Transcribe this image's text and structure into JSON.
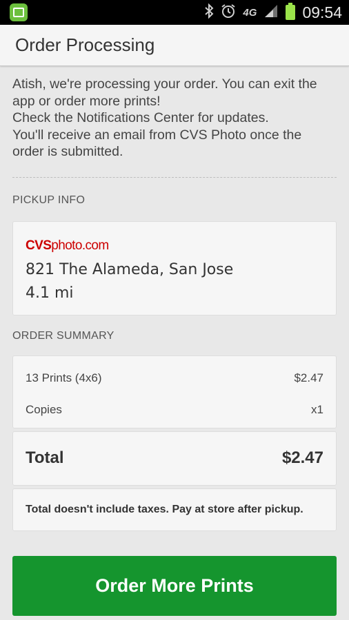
{
  "status_bar": {
    "time": "09:54",
    "network": "4G",
    "icons": [
      "gallery-app-icon",
      "bluetooth-icon",
      "alarm-icon",
      "4g-icon",
      "signal-icon",
      "battery-icon"
    ]
  },
  "header": {
    "title": "Order Processing"
  },
  "intro": {
    "line1": "Atish, we're processing your order. You can exit the app or order more prints!",
    "line2": "Check the Notifications Center for updates.",
    "line3": "You'll receive an email from CVS Photo once the order is submitted."
  },
  "pickup": {
    "section_label": "PICKUP INFO",
    "logo_bold": "CVS",
    "logo_rest": "photo.com",
    "address": "821 The Alameda, San Jose",
    "distance": "4.1 mi"
  },
  "summary": {
    "section_label": "ORDER SUMMARY",
    "item_label": "13 Prints (4x6)",
    "item_price": "$2.47",
    "copies_label": "Copies",
    "copies_value": "x1",
    "total_label": "Total",
    "total_value": "$2.47",
    "note": "Total doesn't include taxes. Pay at store after pickup."
  },
  "actions": {
    "order_more_label": "Order More Prints"
  },
  "colors": {
    "accent_green": "#15952e",
    "logo_red": "#cc0000",
    "battery_green": "#9be34a"
  }
}
